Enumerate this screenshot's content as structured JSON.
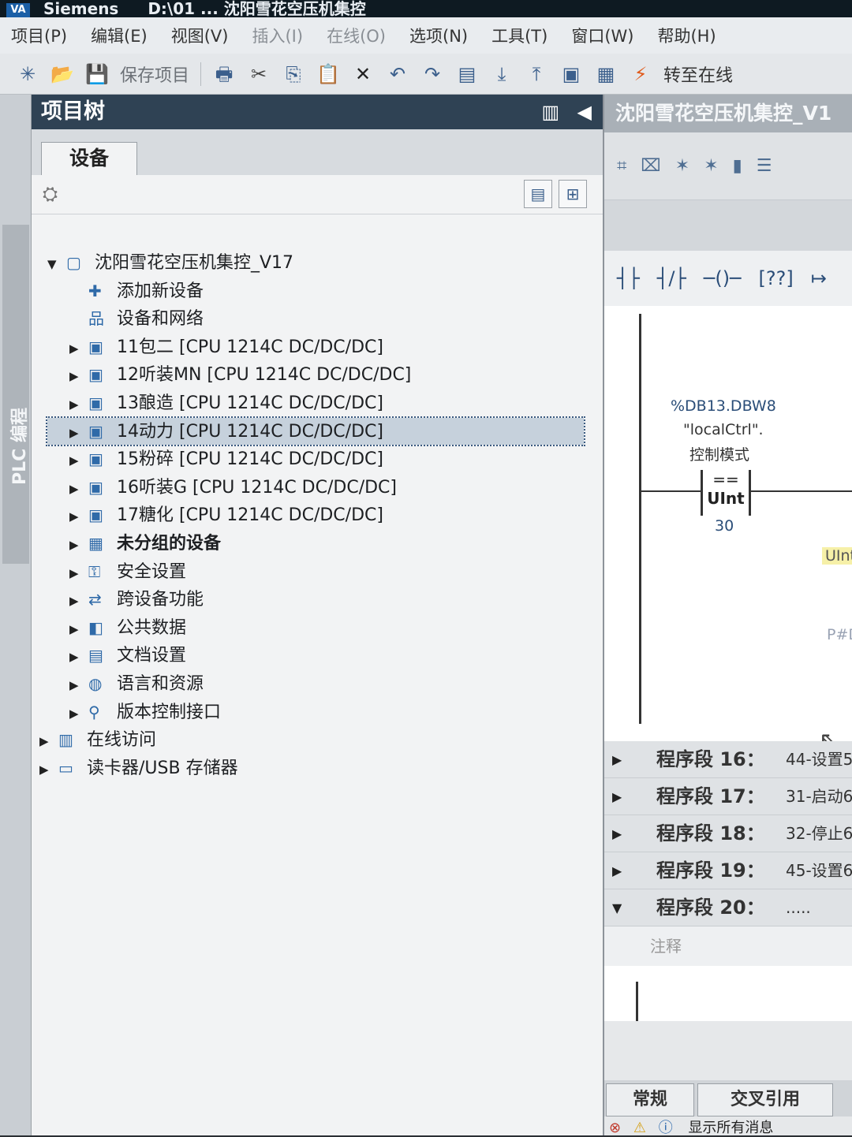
{
  "titlebar": {
    "app": "Siemens",
    "title": "D:\\01 ... 沈阳雪花空压机集控"
  },
  "menu": [
    "项目(P)",
    "编辑(E)",
    "视图(V)",
    "插入(I)",
    "在线(O)",
    "选项(N)",
    "工具(T)",
    "窗口(W)",
    "帮助(H)"
  ],
  "toolbar": {
    "save_label": "保存项目",
    "go_online_label": "转至在线"
  },
  "side_tab": {
    "label": "PLC 编程"
  },
  "project_tree": {
    "title": "项目树",
    "tab_label": "设备",
    "items": [
      {
        "arrow": "▼",
        "icon": "project-icon",
        "label": "沈阳雪花空压机集控_V17",
        "bold": false
      },
      {
        "arrow": "",
        "icon": "add-device-icon",
        "label": "添加新设备",
        "bold": false
      },
      {
        "arrow": "",
        "icon": "network-icon",
        "label": "设备和网络",
        "bold": false
      },
      {
        "arrow": "▶",
        "icon": "plc-icon",
        "label": "11包二 [CPU 1214C DC/DC/DC]",
        "bold": false
      },
      {
        "arrow": "▶",
        "icon": "plc-icon",
        "label": "12听装MN [CPU 1214C DC/DC/DC]",
        "bold": false
      },
      {
        "arrow": "▶",
        "icon": "plc-icon",
        "label": "13酿造 [CPU 1214C DC/DC/DC]",
        "bold": false
      },
      {
        "arrow": "▶",
        "icon": "plc-icon",
        "label": "14动力 [CPU 1214C DC/DC/DC]",
        "bold": false,
        "selected": true
      },
      {
        "arrow": "▶",
        "icon": "plc-icon",
        "label": "15粉碎 [CPU 1214C DC/DC/DC]",
        "bold": false
      },
      {
        "arrow": "▶",
        "icon": "plc-icon",
        "label": "16听装G [CPU 1214C DC/DC/DC]",
        "bold": false
      },
      {
        "arrow": "▶",
        "icon": "plc-icon",
        "label": "17糖化 [CPU 1214C DC/DC/DC]",
        "bold": false
      },
      {
        "arrow": "▶",
        "icon": "ungrouped-devices-icon",
        "label": "未分组的设备",
        "bold": true
      },
      {
        "arrow": "▶",
        "icon": "security-icon",
        "label": "安全设置",
        "bold": false
      },
      {
        "arrow": "▶",
        "icon": "cross-device-icon",
        "label": "跨设备功能",
        "bold": false
      },
      {
        "arrow": "▶",
        "icon": "common-data-icon",
        "label": "公共数据",
        "bold": false
      },
      {
        "arrow": "▶",
        "icon": "document-settings-icon",
        "label": "文档设置",
        "bold": false
      },
      {
        "arrow": "▶",
        "icon": "language-icon",
        "label": "语言和资源",
        "bold": false
      },
      {
        "arrow": "▶",
        "icon": "version-control-icon",
        "label": "版本控制接口",
        "bold": false
      },
      {
        "arrow": "▶",
        "icon": "online-access-icon",
        "label": "在线访问",
        "bold": false
      },
      {
        "arrow": "▶",
        "icon": "card-reader-icon",
        "label": "读卡器/USB 存储器",
        "bold": false
      }
    ]
  },
  "editor": {
    "title": "沈阳雪花空压机集控_V1",
    "operand_address": "%DB13.DBW8",
    "operand_symbol": "\"localCtrl\".",
    "operand_comment": "控制模式",
    "compare_op": "==",
    "compare_type": "UInt",
    "compare_value": "30",
    "right_type": "UInt",
    "right_param": "P#D",
    "segments": [
      {
        "label": "程序段 16：",
        "comment": "44-设置5"
      },
      {
        "label": "程序段 17：",
        "comment": "31-启动6"
      },
      {
        "label": "程序段 18：",
        "comment": "32-停止6"
      },
      {
        "label": "程序段 19：",
        "comment": "45-设置6"
      },
      {
        "label": "程序段 20：",
        "comment": "....."
      }
    ],
    "comment_placeholder": "注释"
  },
  "inspector": {
    "tabs": [
      "常规",
      "交叉引用"
    ],
    "message": "显示所有消息"
  },
  "colors": {
    "tree_header_bg": "#2f4254",
    "selected_row": "#c6d1dc",
    "accent_blue": "#2a4d78"
  }
}
